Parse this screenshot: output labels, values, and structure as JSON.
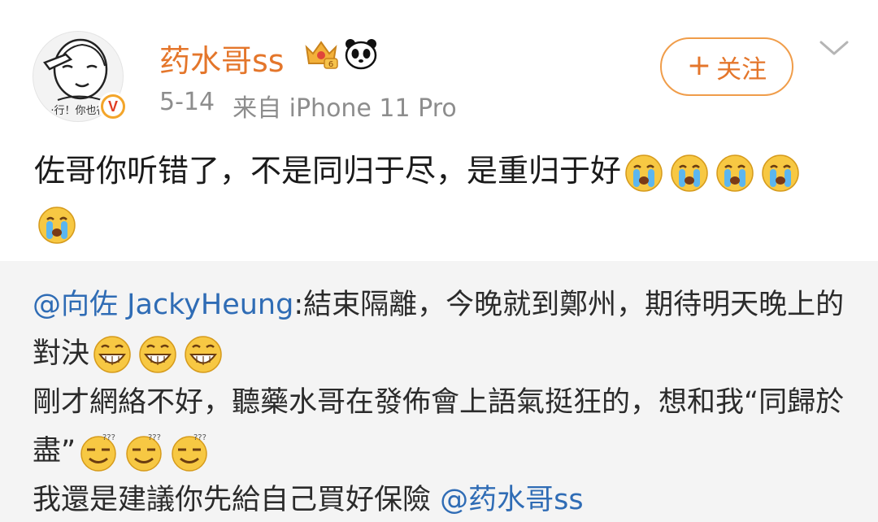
{
  "author": {
    "name": "药水哥ss",
    "avatar_caption": "·行！你也行",
    "verify_mark": "V",
    "date": "5-14",
    "source": "来自 iPhone 11 Pro"
  },
  "actions": {
    "follow_plus": "+",
    "follow_label": "关注"
  },
  "post": {
    "text": "佐哥你听错了，不是同归于尽，是重归于好",
    "emoji_count": 5,
    "emoji_name": "crying-face"
  },
  "repost": {
    "mention_author": "@向佐 JackyHeung",
    "line1": ":結束隔離，今晚就到鄭州，期待明天晚上的對決",
    "line2": "剛才網絡不好，聽藥水哥在發佈會上語氣挺狂的，想和我“同歸於盡”",
    "line3": "我還是建議你先給自己買好保險 ",
    "mention_tail": "@药水哥ss"
  },
  "colors": {
    "username": "#e4762b",
    "mention": "#2f6cb5",
    "follow_border": "#f09d4a",
    "repost_bg": "#f4f4f4",
    "meta": "#8d8d8d"
  }
}
